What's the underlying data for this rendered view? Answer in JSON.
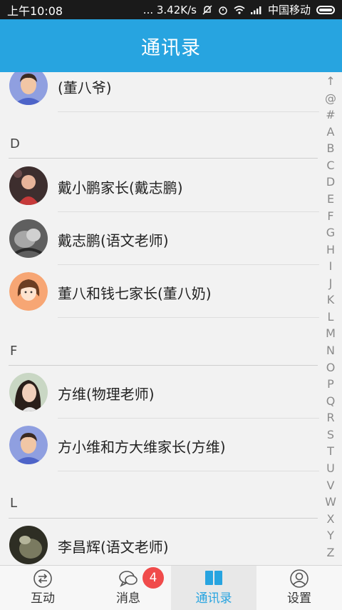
{
  "status_bar": {
    "time": "上午10:08",
    "speed": "... 3.42K/s",
    "carrier": "中国移动"
  },
  "header": {
    "title": "通讯录"
  },
  "contacts": {
    "partial_top": {
      "label": "(董八爷)"
    },
    "sections": [
      {
        "letter": "D",
        "items": [
          {
            "label": "戴小鹏家长(戴志鹏)"
          },
          {
            "label": "戴志鹏(语文老师)"
          },
          {
            "label": "董八和钱七家长(董八奶)"
          }
        ]
      },
      {
        "letter": "F",
        "items": [
          {
            "label": "方维(物理老师)"
          },
          {
            "label": "方小维和方大维家长(方维)"
          }
        ]
      },
      {
        "letter": "L",
        "items": [
          {
            "label": "李昌辉(语文老师)"
          }
        ]
      }
    ]
  },
  "index_bar": [
    "↑",
    "@",
    "#",
    "A",
    "B",
    "C",
    "D",
    "E",
    "F",
    "G",
    "H",
    "I",
    "J",
    "K",
    "L",
    "M",
    "N",
    "O",
    "P",
    "Q",
    "R",
    "S",
    "T",
    "U",
    "V",
    "W",
    "X",
    "Y",
    "Z"
  ],
  "tabs": [
    {
      "label": "互动",
      "icon": "interact-icon"
    },
    {
      "label": "消息",
      "icon": "chat-bubble-icon",
      "badge": "4"
    },
    {
      "label": "通讯录",
      "icon": "contacts-book-icon",
      "active": true
    },
    {
      "label": "设置",
      "icon": "person-settings-icon"
    }
  ],
  "colors": {
    "accent": "#27a4e0",
    "badge": "#f04b4b"
  }
}
